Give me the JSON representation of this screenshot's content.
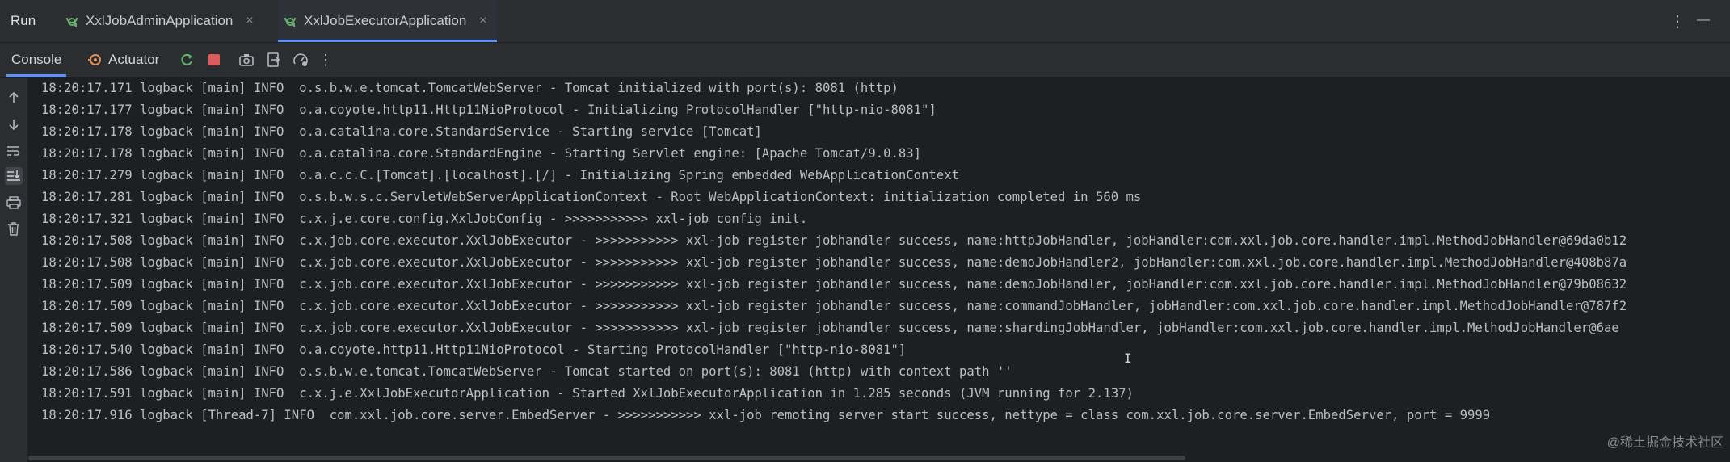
{
  "run_bar": {
    "title": "Run",
    "tabs": [
      {
        "label": "XxlJobAdminApplication",
        "active": false
      },
      {
        "label": "XxlJobExecutorApplication",
        "active": true
      }
    ],
    "close_glyph": "×",
    "more_glyph": "⋮",
    "minimize_glyph": "—"
  },
  "toolbar": {
    "console_label": "Console",
    "actuator_label": "Actuator",
    "more_glyph": "⋮"
  },
  "colors": {
    "accent": "#5b92ff",
    "stop_red": "#db5c5c",
    "rerun_green": "#5fb865",
    "background": "#1e1f22",
    "text": "#bcbec4"
  },
  "log_lines": [
    "18:20:17.171 logback [main] INFO  o.s.b.w.e.tomcat.TomcatWebServer - Tomcat initialized with port(s): 8081 (http)",
    "18:20:17.177 logback [main] INFO  o.a.coyote.http11.Http11NioProtocol - Initializing ProtocolHandler [\"http-nio-8081\"]",
    "18:20:17.178 logback [main] INFO  o.a.catalina.core.StandardService - Starting service [Tomcat]",
    "18:20:17.178 logback [main] INFO  o.a.catalina.core.StandardEngine - Starting Servlet engine: [Apache Tomcat/9.0.83]",
    "18:20:17.279 logback [main] INFO  o.a.c.c.C.[Tomcat].[localhost].[/] - Initializing Spring embedded WebApplicationContext",
    "18:20:17.281 logback [main] INFO  o.s.b.w.s.c.ServletWebServerApplicationContext - Root WebApplicationContext: initialization completed in 560 ms",
    "18:20:17.321 logback [main] INFO  c.x.j.e.core.config.XxlJobConfig - >>>>>>>>>>> xxl-job config init.",
    "18:20:17.508 logback [main] INFO  c.x.job.core.executor.XxlJobExecutor - >>>>>>>>>>> xxl-job register jobhandler success, name:httpJobHandler, jobHandler:com.xxl.job.core.handler.impl.MethodJobHandler@69da0b12",
    "18:20:17.508 logback [main] INFO  c.x.job.core.executor.XxlJobExecutor - >>>>>>>>>>> xxl-job register jobhandler success, name:demoJobHandler2, jobHandler:com.xxl.job.core.handler.impl.MethodJobHandler@408b87a",
    "18:20:17.509 logback [main] INFO  c.x.job.core.executor.XxlJobExecutor - >>>>>>>>>>> xxl-job register jobhandler success, name:demoJobHandler, jobHandler:com.xxl.job.core.handler.impl.MethodJobHandler@79b08632",
    "18:20:17.509 logback [main] INFO  c.x.job.core.executor.XxlJobExecutor - >>>>>>>>>>> xxl-job register jobhandler success, name:commandJobHandler, jobHandler:com.xxl.job.core.handler.impl.MethodJobHandler@787f2",
    "18:20:17.509 logback [main] INFO  c.x.job.core.executor.XxlJobExecutor - >>>>>>>>>>> xxl-job register jobhandler success, name:shardingJobHandler, jobHandler:com.xxl.job.core.handler.impl.MethodJobHandler@6ae",
    "18:20:17.540 logback [main] INFO  o.a.coyote.http11.Http11NioProtocol - Starting ProtocolHandler [\"http-nio-8081\"]",
    "18:20:17.586 logback [main] INFO  o.s.b.w.e.tomcat.TomcatWebServer - Tomcat started on port(s): 8081 (http) with context path ''",
    "18:20:17.591 logback [main] INFO  c.x.j.e.XxlJobExecutorApplication - Started XxlJobExecutorApplication in 1.285 seconds (JVM running for 2.137)",
    "18:20:17.916 logback [Thread-7] INFO  com.xxl.job.core.server.EmbedServer - >>>>>>>>>>> xxl-job remoting server start success, nettype = class com.xxl.job.core.server.EmbedServer, port = 9999"
  ],
  "watermark": "@稀土掘金技术社区",
  "icons": {
    "tab_icon": "spring-boot-run-icon",
    "rerun": "rerun-icon",
    "stop": "stop-icon",
    "screenshot": "camera-icon",
    "export": "export-icon",
    "dashboard": "dashboard-icon",
    "scroll_up": "arrow-up-icon",
    "scroll_down": "arrow-down-icon",
    "soft_wrap": "soft-wrap-icon",
    "scroll_end": "scroll-to-end-icon",
    "print": "print-icon",
    "clear": "trash-icon"
  }
}
